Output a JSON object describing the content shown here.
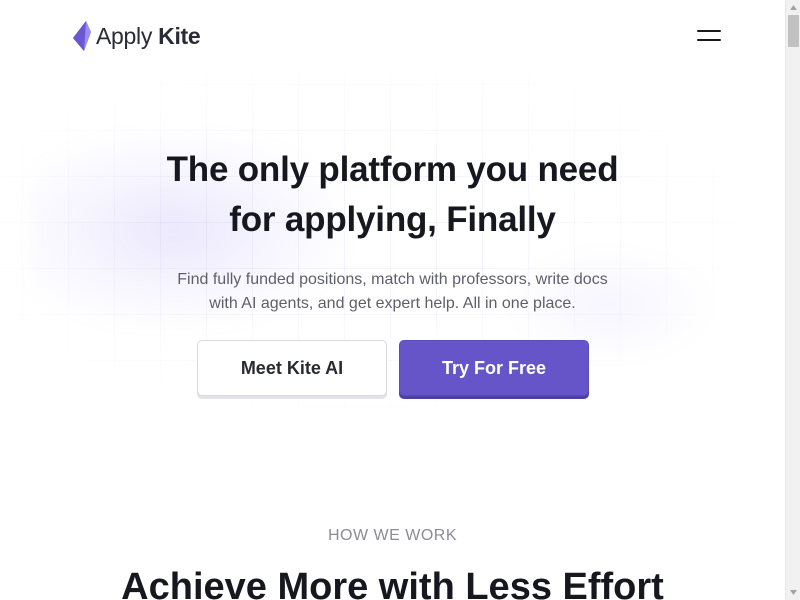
{
  "header": {
    "logo_word1": "Apply",
    "logo_word2": "Kite",
    "logo_icon": "kite-logo-icon",
    "menu_icon": "hamburger-menu-icon"
  },
  "hero": {
    "title_line1": "The only platform you need",
    "title_line2": "for applying, Finally",
    "subtitle_line1": "Find fully funded positions, match with professors, write docs",
    "subtitle_line2": "with AI agents, and get expert help. All in one place.",
    "secondary_button": "Meet Kite AI",
    "primary_button": "Try For Free"
  },
  "how_we_work": {
    "eyebrow": "HOW WE WORK",
    "title": "Achieve More with Less Effort"
  },
  "colors": {
    "brand": "#6654c9",
    "brand_light": "#8a78e8",
    "text_dark": "#17171f",
    "text_muted": "#5f5f6a"
  },
  "icons": {
    "scroll_up": "scroll-up-arrow-icon",
    "scroll_down": "scroll-down-arrow-icon"
  }
}
